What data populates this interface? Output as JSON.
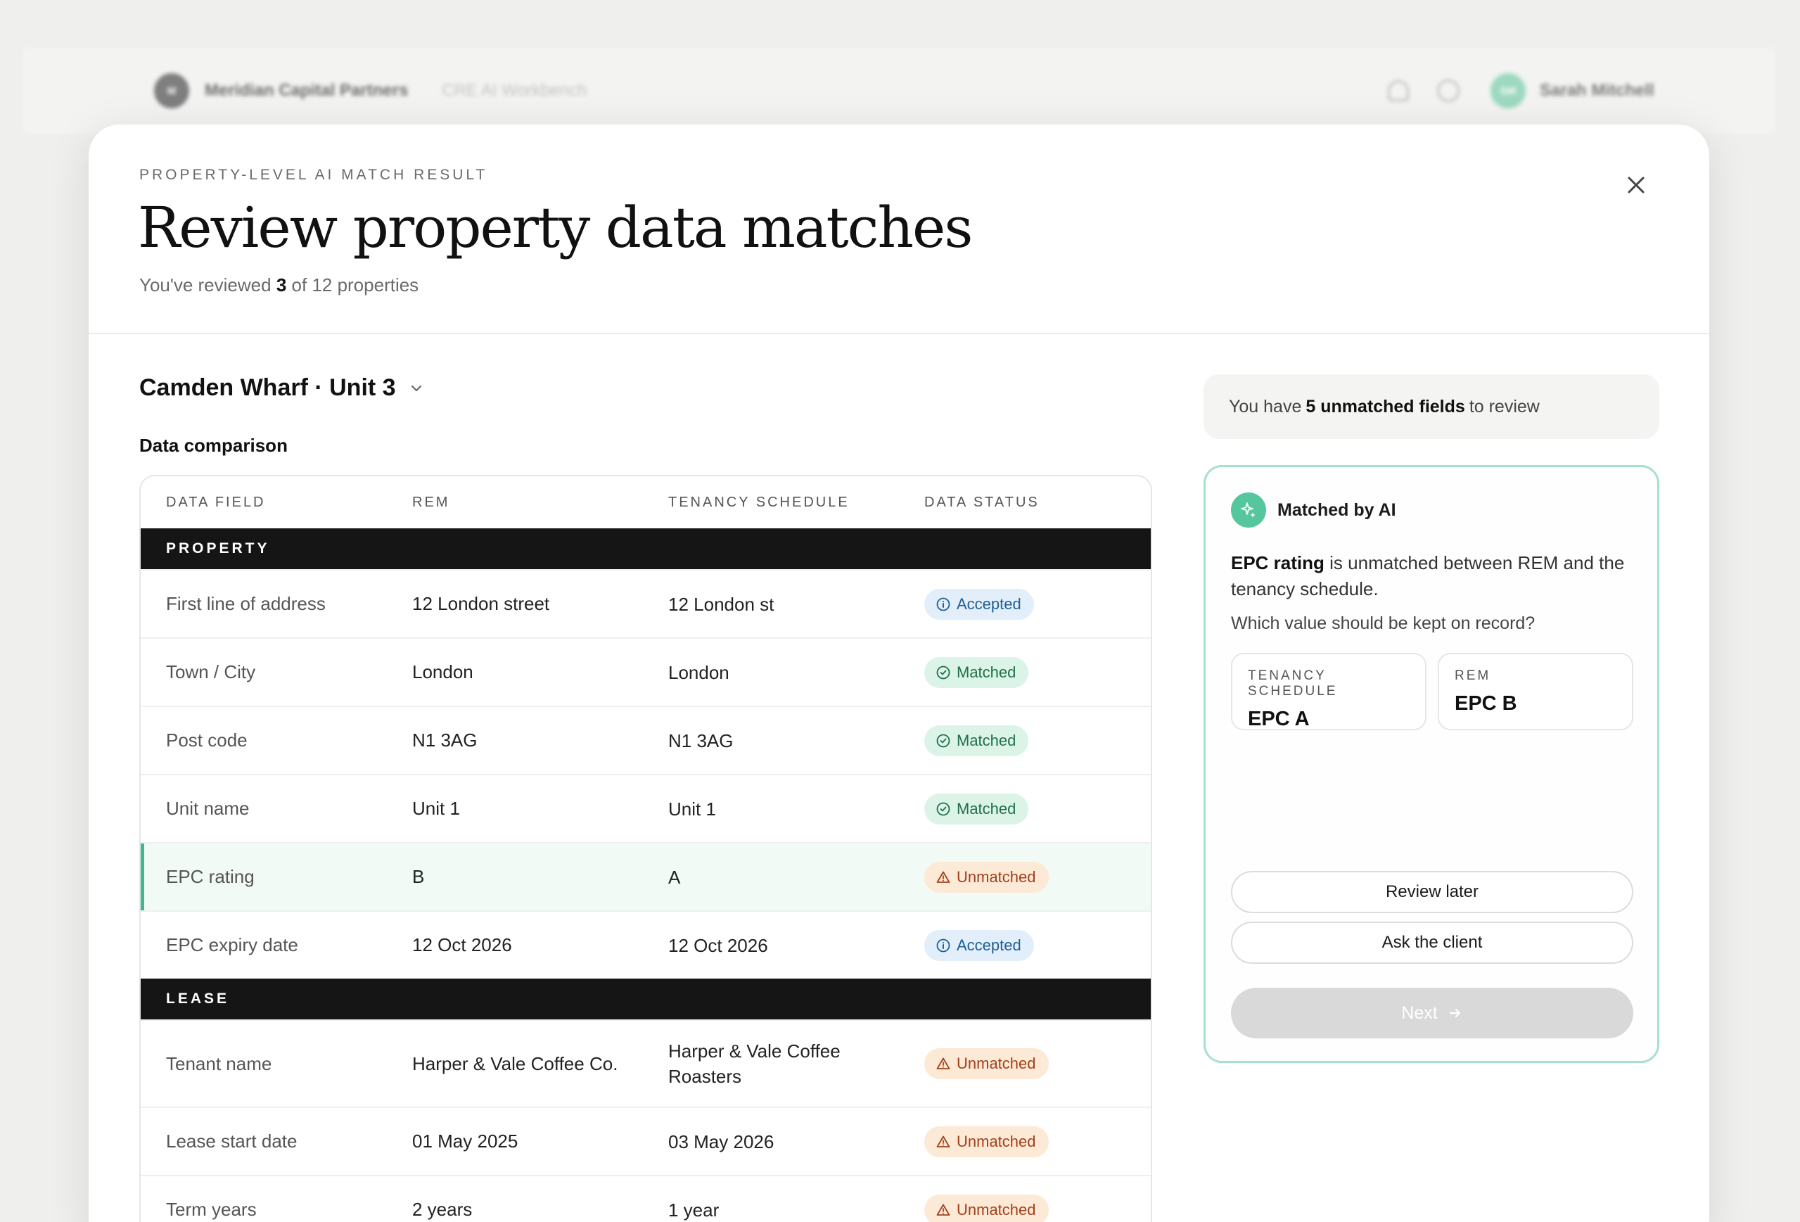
{
  "app": {
    "org_initial": "M",
    "org_name": "Meridian Capital Partners",
    "product": "CRE AI Workbench",
    "user_initials": "SM",
    "user_name": "Sarah Mitchell"
  },
  "modal": {
    "eyebrow": "PROPERTY-LEVEL AI MATCH RESULT",
    "title": "Review property data matches",
    "subtitle_pre": "You've reviewed",
    "reviewed": "3",
    "subtitle_post": "of 12 properties"
  },
  "property_selector": {
    "label": "Camden Wharf · Unit 3"
  },
  "comparison": {
    "title": "Data comparison",
    "columns": [
      "DATA FIELD",
      "REM",
      "TENANCY SCHEDULE",
      "DATA STATUS"
    ],
    "groups": [
      {
        "name": "PROPERTY",
        "rows": [
          {
            "field": "First line of address",
            "rem": "12 London street",
            "tenancy": "12 London st",
            "status": "Accepted"
          },
          {
            "field": "Town / City",
            "rem": "London",
            "tenancy": "London",
            "status": "Matched"
          },
          {
            "field": "Post code",
            "rem": "N1 3AG",
            "tenancy": "N1 3AG",
            "status": "Matched"
          },
          {
            "field": "Unit name",
            "rem": "Unit 1",
            "tenancy": "Unit 1",
            "status": "Matched"
          },
          {
            "field": "EPC rating",
            "rem": "B",
            "tenancy": "A",
            "status": "Unmatched"
          },
          {
            "field": "EPC expiry date",
            "rem": "12 Oct 2026",
            "tenancy": "12 Oct 2026",
            "status": "Accepted"
          }
        ]
      },
      {
        "name": "LEASE",
        "rows": [
          {
            "field": "Tenant name",
            "rem": "Harper & Vale Coffee Co.",
            "tenancy": "Harper & Vale Coffee Roasters",
            "status": "Unmatched"
          },
          {
            "field": "Lease start date",
            "rem": "01 May 2025",
            "tenancy": "03 May 2026",
            "status": "Unmatched"
          },
          {
            "field": "Term years",
            "rem": "2 years",
            "tenancy": "1 year",
            "status": "Unmatched"
          }
        ]
      }
    ]
  },
  "notice": {
    "pre": "You have",
    "count": "5 unmatched fields",
    "post": "to review"
  },
  "ai_card": {
    "title": "Matched by AI",
    "field": "EPC rating",
    "message": "is unmatched between REM and the tenancy schedule.",
    "question": "Which value should be kept on record?",
    "options": [
      {
        "label": "TENANCY SCHEDULE",
        "value": "EPC A"
      },
      {
        "label": "REM",
        "value": "EPC B"
      }
    ],
    "review_later": "Review later",
    "ask_client": "Ask the client",
    "next": "Next"
  },
  "colors": {
    "accent": "#3fb98a",
    "accepted": "#1f5f96",
    "matched": "#207049",
    "unmatched": "#a3401b"
  }
}
